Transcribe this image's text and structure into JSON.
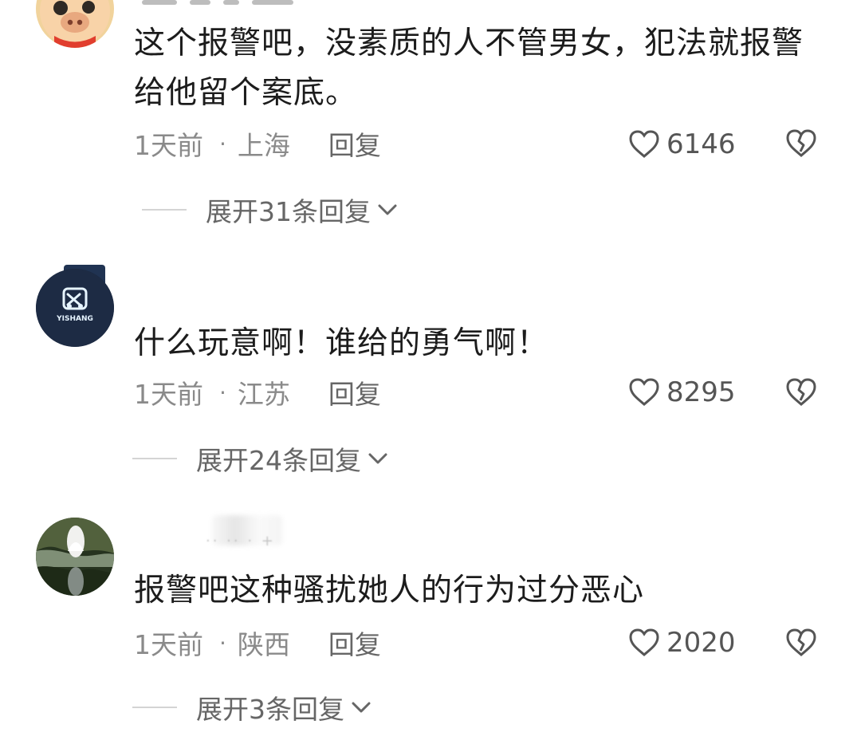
{
  "comments": [
    {
      "username": "",
      "text": "这个报警吧，没素质的人不管男女，犯法就报警给他留个案底。",
      "time": "1天前",
      "location": "上海",
      "reply_label": "回复",
      "likes": "6146",
      "expand_label": "展开31条回复",
      "avatar": "cartoon-face-avatar"
    },
    {
      "username": "",
      "text": "什么玩意啊！谁给的勇气啊！",
      "time": "1天前",
      "location": "江苏",
      "reply_label": "回复",
      "likes": "8295",
      "expand_label": "展开24条回复",
      "avatar": "yishang-logo-avatar",
      "avatar_text": "YISHANG"
    },
    {
      "username": "",
      "text": "报警吧这种骚扰她人的行为过分恶心",
      "time": "1天前",
      "location": "陕西",
      "reply_label": "回复",
      "likes": "2020",
      "expand_label": "展开3条回复",
      "avatar": "nature-photo-avatar"
    }
  ],
  "icons": {
    "like": "heart-icon",
    "dislike": "broken-heart-icon",
    "expand": "chevron-down-icon"
  },
  "colors": {
    "primary_text": "#1c1c1c",
    "meta_text": "#8a8a8a",
    "reply_text": "#666666",
    "divider": "#d4d4d4"
  }
}
